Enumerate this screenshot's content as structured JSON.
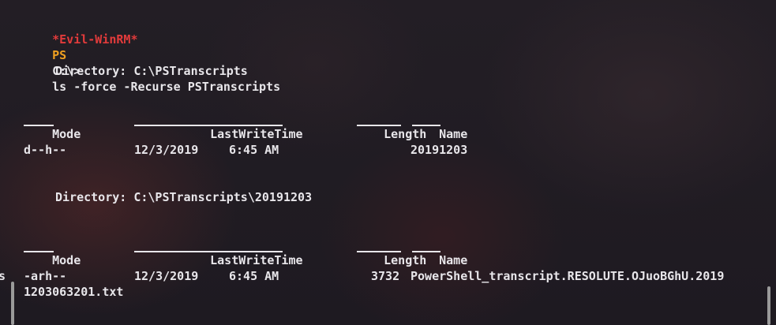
{
  "prompt": {
    "evil": "*Evil-WinRM*",
    "ps": "PS",
    "path": "C:\\>",
    "command": "ls -force -Recurse PSTranscripts"
  },
  "block1": {
    "directory": "Directory: C:\\PSTranscripts",
    "header_mode": "Mode",
    "header_lastwrite": "LastWriteTime",
    "header_length": "Length",
    "header_name": "Name",
    "row_mode": "d--h--",
    "row_date": "12/3/2019",
    "row_time": "6:45 AM",
    "row_length": "",
    "row_name": "20191203"
  },
  "block2": {
    "directory": "Directory: C:\\PSTranscripts\\20191203",
    "header_mode": "Mode",
    "header_lastwrite": "LastWriteTime",
    "header_length": "Length",
    "header_name": "Name",
    "row_mode": "-arh--",
    "row_date": "12/3/2019",
    "row_time": "6:45 AM",
    "row_length": "3732",
    "row_name": "PowerShell_transcript.RESOLUTE.OJuoBGhU.2019",
    "row_name_wrap": "1203063201.txt"
  },
  "left_glyph": "s"
}
